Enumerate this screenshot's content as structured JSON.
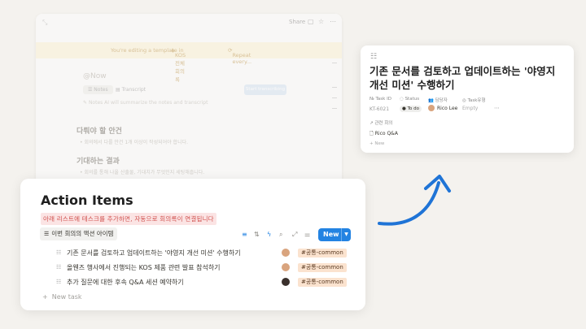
{
  "editor": {
    "share_label": "Share",
    "banner_text": "You're editing a template in",
    "banner_db": "KOS 전체 회의록",
    "banner_repeat": "Repeat every...",
    "now_label": "@Now",
    "tab_notes": "Notes",
    "tab_transcript": "Transcript",
    "start_label": "Start transcribing",
    "notes_placeholder": "Notes AI will summarize the notes and transcript",
    "section1_title": "다뤄야 할 안건",
    "section1_bullet": "회의에서 다룰 안건 1개 이상이 작성되어야 합니다.",
    "section2_title": "기대하는 결과",
    "section2_bullet": "회의를 통해 나올 산출물, 기대치가 무엇인지 세팅해줍니다."
  },
  "action": {
    "title": "Action Items",
    "notice": "아래 리스트에 테스크를 추가하면, 자동으로 회의록이 연결됩니다",
    "view_label": "이번 회의의 액션 아이템",
    "new_label": "New",
    "new_task": "New task",
    "rows": [
      {
        "title": "기존 문서를 검토하고 업데이트하는 '야영지 개선 미션' 수행하기",
        "tag": "#공통-common",
        "avatar": "#d9a47e"
      },
      {
        "title": "올웬즈 행사에서 진행되는 KOS 제품 관련 발표 참석하기",
        "tag": "#공통-common",
        "avatar": "#d9a47e"
      },
      {
        "title": "추가 질문에 대한 후속 Q&A 세션 예약하기",
        "tag": "#공통-common",
        "avatar": "#3a302c"
      }
    ]
  },
  "detail": {
    "title": "기존 문서를 검토하고 업데이트하는 '야영지 개선 미션' 수행하기",
    "prop_taskid": "Task ID",
    "prop_status": "Status",
    "prop_assignee": "담당자",
    "prop_type": "Task유형",
    "val_taskid": "KT-6021",
    "val_status": "To do",
    "val_assignee": "Rico Lee",
    "val_type": "Empty",
    "related_label": "관련 회의",
    "related_item": "Rico Q&A",
    "new_label": "New"
  },
  "colors": {
    "accent": "#2383e2",
    "notice_text": "#d0514e",
    "tag_bg": "#fbe3cf",
    "arrow": "#1f74d6"
  }
}
